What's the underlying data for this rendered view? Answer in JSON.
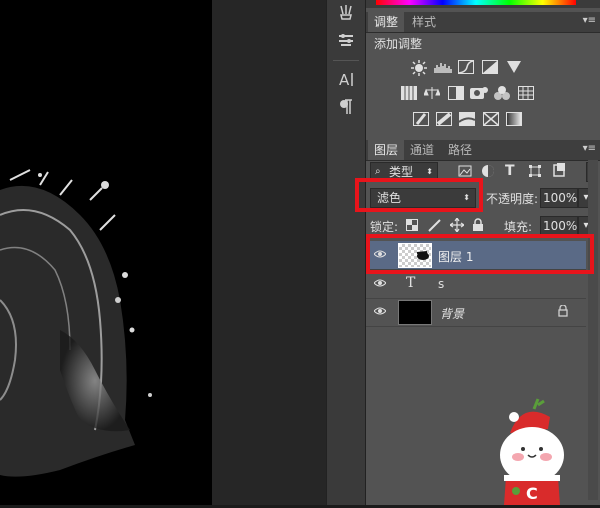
{
  "adjustments": {
    "tab_active": "调整",
    "tab_other": "样式",
    "heading": "添加调整"
  },
  "layers_panel": {
    "tabs": [
      "图层",
      "通道",
      "路径"
    ],
    "filter_label": "类型",
    "blend_mode": "滤色",
    "opacity_label": "不透明度:",
    "opacity_value": "100%",
    "lock_label": "锁定:",
    "fill_label": "填充:",
    "fill_value": "100%",
    "layers": [
      {
        "name": "图层 1",
        "type": "image",
        "selected": true
      },
      {
        "name": "s",
        "type": "text",
        "selected": false
      },
      {
        "name": "背景",
        "type": "background",
        "selected": false,
        "locked": true
      }
    ]
  },
  "colors": {
    "highlight": "#e8141b",
    "selected_layer": "#5a6a86"
  }
}
